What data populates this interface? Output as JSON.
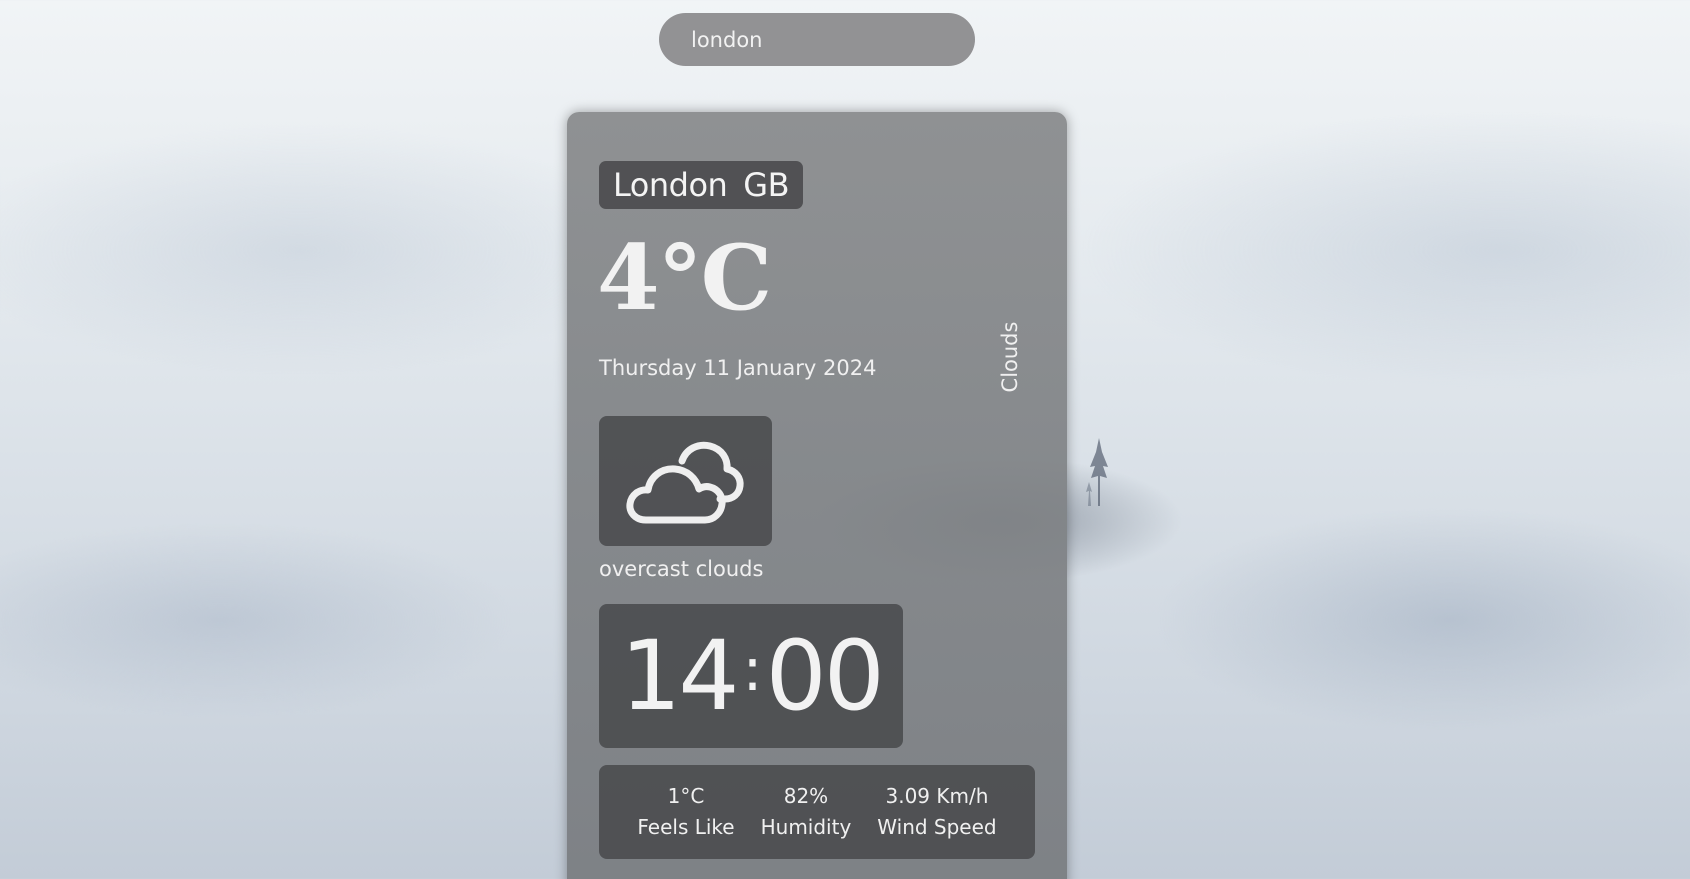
{
  "search": {
    "value": "london",
    "placeholder": ""
  },
  "location": {
    "city": "London",
    "country": "GB"
  },
  "weather": {
    "temperature": "4°C",
    "date": "Thursday 11 January 2024",
    "main": "Clouds",
    "description": "overcast clouds",
    "icon": "cloudy-icon"
  },
  "clock": {
    "hours": "14",
    "separator": ":",
    "minutes": "00"
  },
  "stats": [
    {
      "value": "1°C",
      "label": "Feels Like"
    },
    {
      "value": "82%",
      "label": "Humidity"
    },
    {
      "value": "3.09 Km/h",
      "label": "Wind Speed"
    }
  ],
  "colors": {
    "panel": "#8a8c8e",
    "tile": "#48494b",
    "text": "#f2f2f2"
  }
}
